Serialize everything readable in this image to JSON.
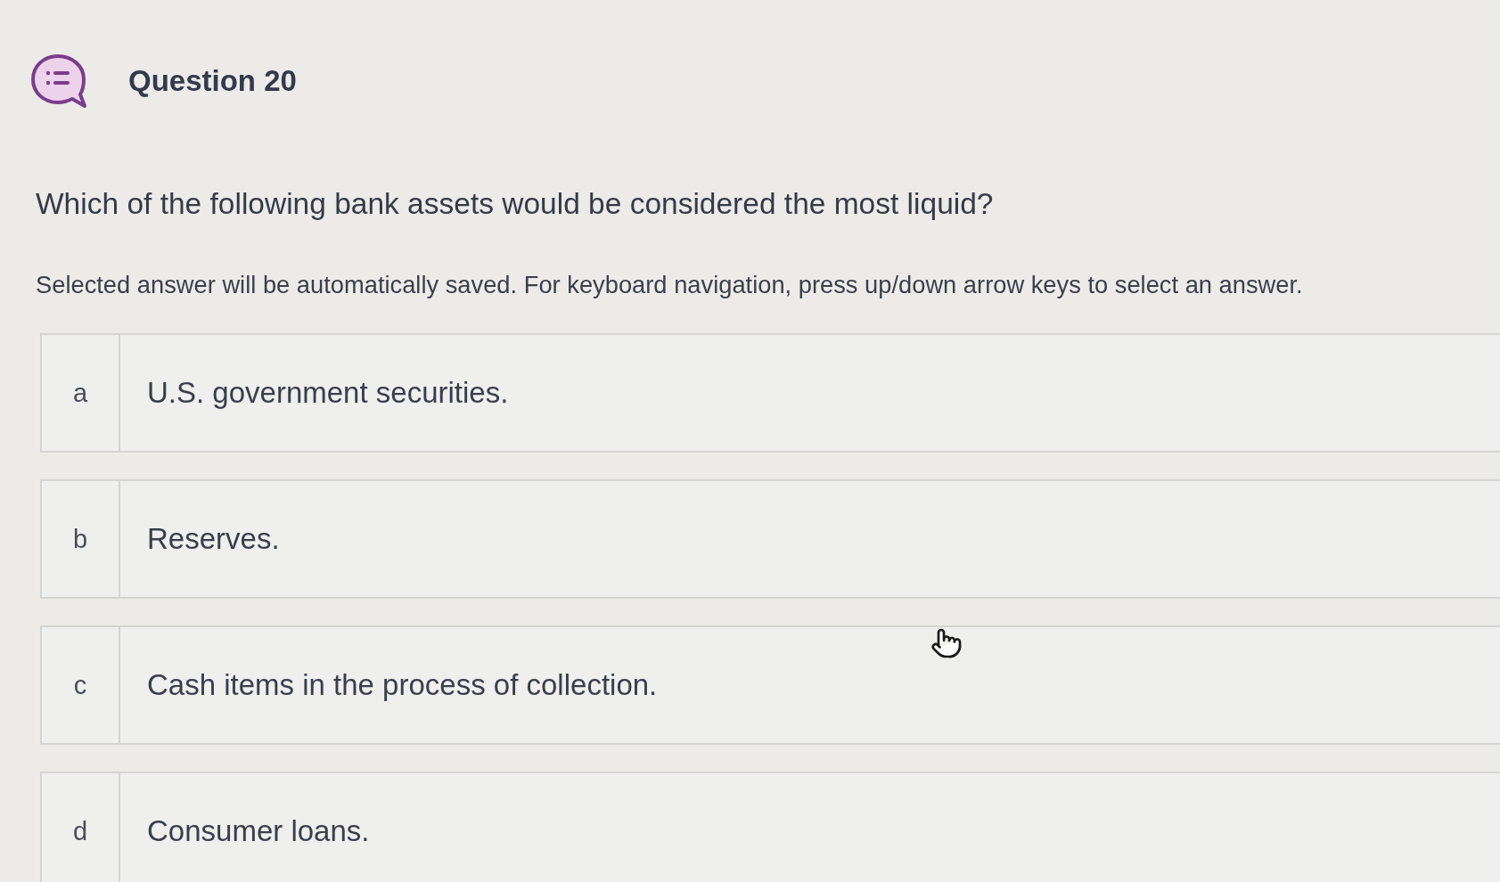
{
  "question": {
    "title": "Question 20",
    "text": "Which of the following bank assets would be considered the most liquid?",
    "instruction": "Selected answer will be automatically saved. For keyboard navigation, press up/down arrow keys to select an answer."
  },
  "options": [
    {
      "letter": "a",
      "text": "U.S. government securities.",
      "selected": false
    },
    {
      "letter": "b",
      "text": "Reserves.",
      "selected": false
    },
    {
      "letter": "c",
      "text": "Cash items in the process of collection.",
      "selected": false
    },
    {
      "letter": "d",
      "text": "Consumer loans.",
      "selected": false
    }
  ]
}
